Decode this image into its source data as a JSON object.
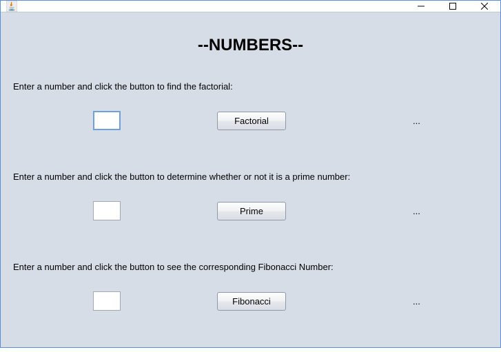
{
  "window": {
    "title": ""
  },
  "heading": "--NUMBERS--",
  "sections": {
    "factorial": {
      "instruction": "Enter a number and click the button to find the factorial:",
      "input_value": "",
      "button_label": "Factorial",
      "result": "..."
    },
    "prime": {
      "instruction": "Enter a number and click the button to determine whether or not it is a prime number:",
      "input_value": "",
      "button_label": "Prime",
      "result": "..."
    },
    "fibonacci": {
      "instruction": "Enter a number and click the button to see the corresponding Fibonacci Number:",
      "input_value": "",
      "button_label": "Fibonacci",
      "result": "..."
    }
  }
}
